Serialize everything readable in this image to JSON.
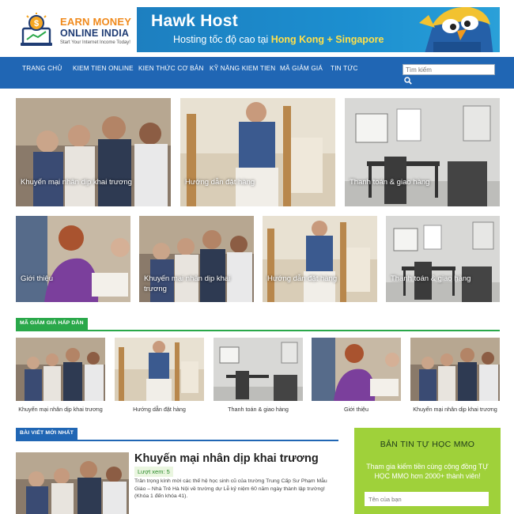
{
  "header": {
    "logo": {
      "line1": "EARN MONEY",
      "line2": "ONLINE INDIA",
      "tagline": "Start Your Internet Income Today!"
    },
    "banner": {
      "title": "Hawk Host",
      "subtitle_prefix": "Hosting tốc độ cao tại ",
      "subtitle_highlight": "Hong Kong + Singapore"
    }
  },
  "nav": {
    "items": [
      "TRANG CHỦ",
      "KIEM TIEN ONLINE",
      "KIEN THỨC CƠ BẢN",
      "KỸ NĂNG KIEM TIEN",
      "MÃ GIẢM GIÁ",
      "TIN TỨC"
    ],
    "search_placeholder": "Tìm kiếm"
  },
  "featured_top": [
    {
      "caption": "Khuyến mại nhân dịp khai trương",
      "image": "students-group"
    },
    {
      "caption": "Hướng dẫn đặt hàng",
      "image": "woman-easel"
    },
    {
      "caption": "Thanh toán & giao hàng",
      "image": "gray-office"
    }
  ],
  "featured_row2": [
    {
      "caption": "Giới thiệu",
      "image": "woman-reading"
    },
    {
      "caption": "Khuyến mại nhân dịp khai trương",
      "image": "students-group"
    },
    {
      "caption": "Hướng dẫn đặt hàng",
      "image": "woman-easel"
    },
    {
      "caption": "Thanh toán & giao hàng",
      "image": "gray-office"
    }
  ],
  "coupons": {
    "heading": "MÃ GIẢM GIÁ HẤP DẪN",
    "items": [
      "Khuyến mại nhân dịp khai trương",
      "Hướng dẫn đặt hàng",
      "Thanh toán & giao hàng",
      "Giới thiệu",
      "Khuyến mại nhân dịp khai trương"
    ]
  },
  "latest": {
    "heading": "BÀI VIẾT MỚI NHẤT",
    "post": {
      "title": "Khuyến mại nhân dịp khai trương",
      "views": "Lượt xem: 5",
      "excerpt": "Trân trọng kính mời các thế hệ học sinh cũ của trường Trung Cấp Sư Phạm Mẫu Giáo – Nhà Trẻ Hà Nội về trường dự Lễ kỷ niệm 60 năm ngày thành lập trường! (Khóa 1 đến khóa 41)."
    }
  },
  "sidebar": {
    "title": "BẢN TIN TỰ HỌC MMO",
    "text": "Tham gia kiếm tiền cùng cộng đồng TỰ HỌC MMO hơn 2000+ thành viên!",
    "name_placeholder": "Tên của bạn"
  },
  "colors": {
    "nav": "#2066b4",
    "coupon_accent": "#2aa84a",
    "latest_accent": "#2066b4",
    "sidebar": "#9fd13a",
    "logo_orange": "#f08a1d"
  }
}
